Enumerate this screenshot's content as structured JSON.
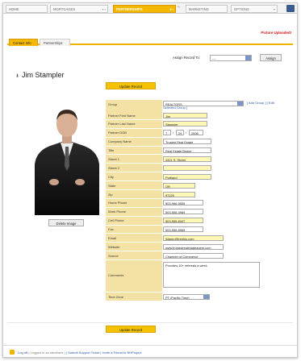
{
  "nav": {
    "tabs": [
      {
        "label": "HOME"
      },
      {
        "label": "MORTGAGES"
      },
      {
        "label": "PARTNERSHIPS"
      },
      {
        "label": "MARKETING"
      },
      {
        "label": "OPTIONS"
      }
    ]
  },
  "notice": "Picture Uploaded!",
  "subtabs": [
    "Contact Info",
    "Partnerships"
  ],
  "assign": {
    "label": "Assign Record To:",
    "value": "---",
    "button": "Assign"
  },
  "contact_name": "Jim Stampler",
  "update_button": "Update Record",
  "delete_image_button": "Delete Image",
  "group": {
    "label": "Group",
    "value": "REALTORS",
    "links": "[ Add Group ] [ Edit",
    "sub": "Selected Group ]"
  },
  "dob": {
    "label": "Partner DOB",
    "month": "7",
    "day": "24",
    "year": "2008"
  },
  "fields": [
    {
      "label": "Partner First Name",
      "value": "Jim",
      "yellow": true,
      "w": 55
    },
    {
      "label": "Partner Last Name",
      "value": "Stampler",
      "yellow": true,
      "w": 55
    }
  ],
  "fields2": [
    {
      "label": "Company Name",
      "value": "Trusted Real Estate",
      "yellow": false,
      "w": 60
    },
    {
      "label": "Title",
      "value": "Real Estate Broker",
      "yellow": false,
      "w": 60
    },
    {
      "label": "Street 1",
      "value": "4321 S. Street",
      "yellow": true,
      "w": 60
    },
    {
      "label": "Street 2",
      "value": "",
      "yellow": true,
      "w": 60
    },
    {
      "label": "City",
      "value": "Portland",
      "yellow": true,
      "w": 60
    },
    {
      "label": "State",
      "value": "OR",
      "yellow": true,
      "w": 40
    },
    {
      "label": "Zip",
      "value": "97225",
      "yellow": true,
      "w": 40
    },
    {
      "label": "Home Phone",
      "value": "503-966-5555",
      "yellow": false,
      "w": 50
    },
    {
      "label": "Work Phone",
      "value": "503-555-4989",
      "yellow": false,
      "w": 50
    },
    {
      "label": "Cell Phone",
      "value": "503-555-8347",
      "yellow": true,
      "w": 50
    },
    {
      "label": "Fax",
      "value": "503-555-8965",
      "yellow": false,
      "w": 50
    },
    {
      "label": "Email",
      "value": "jstamp@freebjs.com",
      "yellow": true,
      "w": 75
    },
    {
      "label": "Website",
      "value": "www.trustedrealestateagent.com",
      "yellow": false,
      "w": 75
    },
    {
      "label": "Source",
      "value": "Chamber of Commerce",
      "yellow": false,
      "w": 75
    }
  ],
  "comments": {
    "label": "Comments",
    "value": "Provides 10+ referrals a week."
  },
  "timezone": {
    "label": "Time Zone",
    "value": "PT (Pacific Time)"
  },
  "footer": {
    "logoff": "Log off",
    "logged_in": "( Logged in as sbrothers )",
    "links": "| Submit Support Ticket | Invite a Friend to BHProject"
  }
}
